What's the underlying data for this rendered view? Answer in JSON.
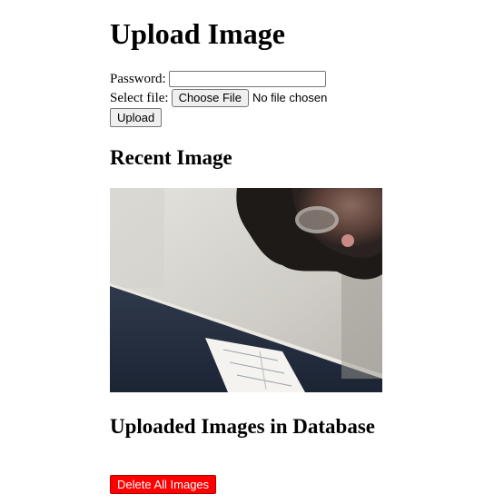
{
  "upload": {
    "title": "Upload Image",
    "password_label": "Password:",
    "password_value": "",
    "file_label": "Select file:",
    "choose_file_label": "Choose File",
    "file_status": "No file chosen",
    "upload_button": "Upload"
  },
  "recent": {
    "title": "Recent Image"
  },
  "database": {
    "title": "Uploaded Images in Database",
    "delete_all_button": "Delete All Images"
  },
  "colors": {
    "delete_button_bg": "#ff0000",
    "delete_button_text": "#ffffff"
  }
}
